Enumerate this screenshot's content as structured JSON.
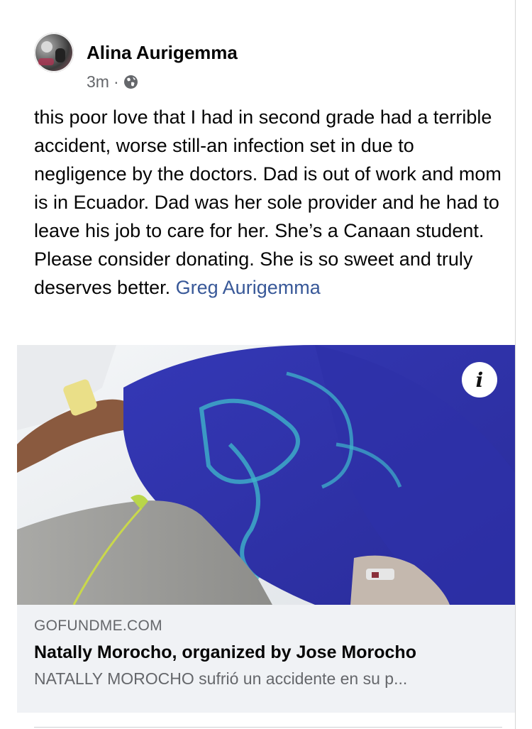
{
  "post": {
    "author": "Alina Aurigemma",
    "time": "3m",
    "separator": "·",
    "privacy_icon": "globe-icon",
    "text": "this poor love that I had in second grade had a terrible accident, worse still-an infection set in due to negligence by the doctors. Dad is out of work and mom is in Ecuador. Dad was her sole provider and he had to leave his job to care for her. She’s a Canaan student. Please consider donating. She is so sweet and truly deserves better.",
    "mention": "Greg Aurigemma"
  },
  "link_preview": {
    "info_icon": "i",
    "domain": "GOFUNDME.COM",
    "title": "Natally Morocho, organized by Jose Morocho",
    "description": "NATALLY MOROCHO sufrió un accidente en su p..."
  },
  "colors": {
    "link": "#385898",
    "secondary_text": "#65676b",
    "preview_bg": "#f0f2f5"
  }
}
